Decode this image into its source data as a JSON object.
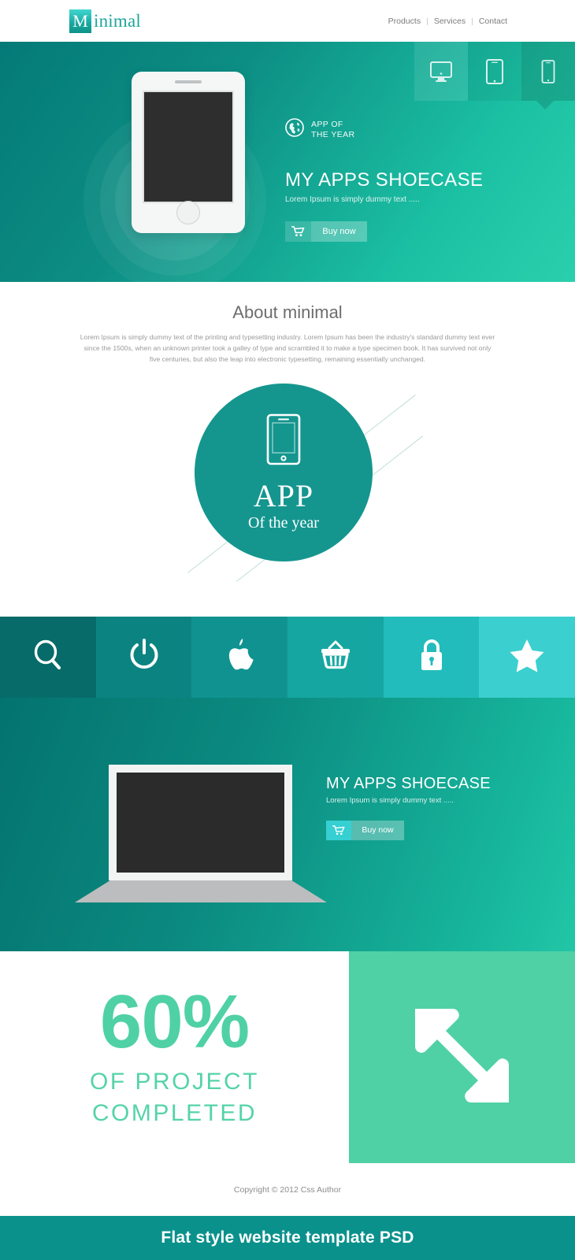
{
  "header": {
    "logo_mark": "M",
    "logo_text": "inimal",
    "nav": [
      {
        "label": "Products"
      },
      {
        "label": "Services"
      },
      {
        "label": "Contact"
      }
    ],
    "nav_separator": "|"
  },
  "hero": {
    "device_tabs": [
      {
        "icon": "desktop-icon",
        "active": false
      },
      {
        "icon": "tablet-icon",
        "active": false
      },
      {
        "icon": "mobile-icon",
        "active": true
      }
    ],
    "award_icon": "globe-icon",
    "award_line1": "APP OF",
    "award_line2": "THE YEAR",
    "title": "MY APPS SHOECASE",
    "subtitle": "Lorem Ipsum is simply dummy text .....",
    "buy_icon": "cart-icon",
    "buy_label": "Buy now",
    "device_mockup": "phone-mockup"
  },
  "about": {
    "title": "About minimal",
    "body": "Lorem Ipsum is simply dummy text of the printing and typesetting industry. Lorem Ipsum has been the industry's standard dummy text ever since the 1500s, when an unknown printer took a galley of type and scrambled it to make a type specimen book. It has survived not only five centuries, but also the leap into electronic typesetting, remaining essentially unchanged.",
    "badge": {
      "icon": "mobile-icon",
      "title": "APP",
      "subtitle": "Of the year"
    }
  },
  "icon_bar": [
    {
      "name": "search-icon",
      "color": "#066b69"
    },
    {
      "name": "power-icon",
      "color": "#0b8481"
    },
    {
      "name": "apple-icon",
      "color": "#109390"
    },
    {
      "name": "basket-icon",
      "color": "#16a6a2"
    },
    {
      "name": "lock-icon",
      "color": "#23bcbc"
    },
    {
      "name": "star-icon",
      "color": "#3ccfcf"
    }
  ],
  "showcase2": {
    "title": "MY APPS SHOECASE",
    "subtitle": "Lorem Ipsum is simply dummy text .....",
    "buy_icon": "cart-icon",
    "buy_label": "Buy now",
    "device_mockup": "laptop-mockup"
  },
  "stats": {
    "percent": "60%",
    "line1": "OF PROJECT",
    "line2": "COMPLETED",
    "arrows_icon": "expand-arrows-icon"
  },
  "footer": {
    "copyright": "Copyright © 2012 Css Author",
    "ribbon": "Flat style  website template PSD"
  },
  "colors": {
    "brand_teal": "#14968f",
    "hero_dark": "#047a77",
    "hero_light": "#2ad0ad",
    "accent_green": "#4fd1a5",
    "ribbon": "#0b918c",
    "cyan": "#36cfd2"
  }
}
